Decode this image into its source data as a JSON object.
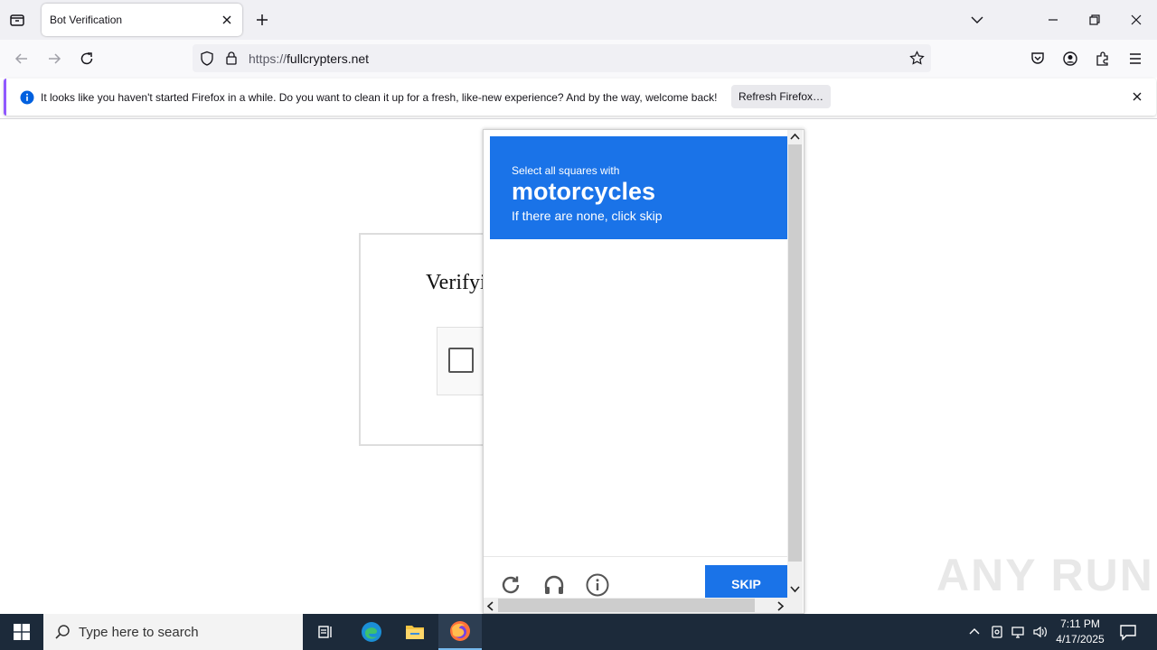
{
  "browser": {
    "tab_title": "Bot Verification",
    "url_scheme": "https://",
    "url_host": "fullcrypters.net"
  },
  "notification": {
    "message": "It looks like you haven't started Firefox in a while. Do you want to clean it up for a fresh, like-new experience? And by the way, welcome back!",
    "button": "Refresh Firefox…"
  },
  "page": {
    "heading_visible": "Verifyi"
  },
  "challenge": {
    "line1": "Select all squares with",
    "target_word": "motorcycles",
    "line3": "If there are none, click skip",
    "skip_label": "SKIP",
    "accent_color": "#1a73e8"
  },
  "watermark": "ANY RUN",
  "taskbar": {
    "search_placeholder": "Type here to search",
    "time": "7:11 PM",
    "date": "4/17/2025"
  }
}
